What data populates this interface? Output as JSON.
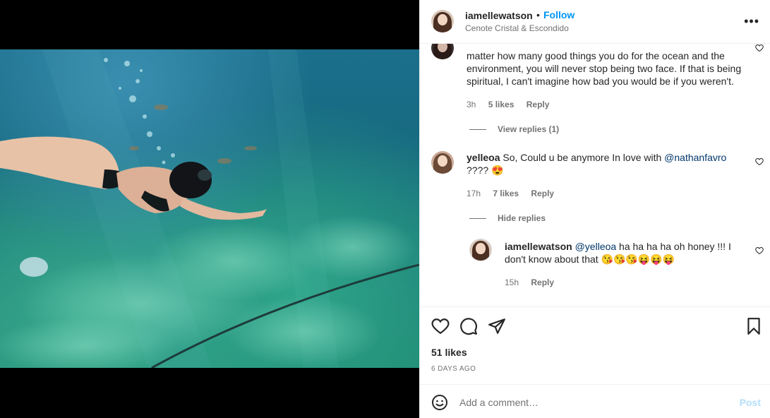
{
  "post": {
    "username": "iamellewatson",
    "follow_label": "Follow",
    "separator": "•",
    "location": "Cenote Cristal & Escondido",
    "more_label": "•••"
  },
  "comments": [
    {
      "text_cut": "matter how many good things you do for the ocean and the environment, you will never stop being two face. If that is being spiritual, I can't imagine how bad you would be if you weren't.",
      "time": "3h",
      "likes": "5 likes",
      "reply_label": "Reply",
      "view_replies": "View replies (1)"
    },
    {
      "username": "yelleoa",
      "text_pre": "So, Could u be anymore In love with ",
      "mention": "@nathanfavro",
      "text_post": "???? 😍",
      "time": "17h",
      "likes": "7 likes",
      "reply_label": "Reply",
      "hide_replies": "Hide replies"
    },
    {
      "username": "iamellewatson",
      "mention": "@yelleoa",
      "text_post": " ha ha ha ha oh honey !!! I don't know about that 😘😘😘😝😝😝",
      "time": "15h",
      "reply_label": "Reply"
    }
  ],
  "footer": {
    "likes": "51 likes",
    "date": "6 DAYS AGO",
    "comment_placeholder": "Add a comment…",
    "post_label": "Post"
  },
  "icons": {
    "like": "heart-icon",
    "comment": "comment-icon",
    "share": "paper-plane-icon",
    "save": "bookmark-icon",
    "emoji": "smiley-icon",
    "more": "more-horizontal-icon"
  },
  "colors": {
    "accent": "#0095f6",
    "post_disabled": "#b2dffc",
    "mention": "#00376b",
    "muted": "#737373"
  }
}
